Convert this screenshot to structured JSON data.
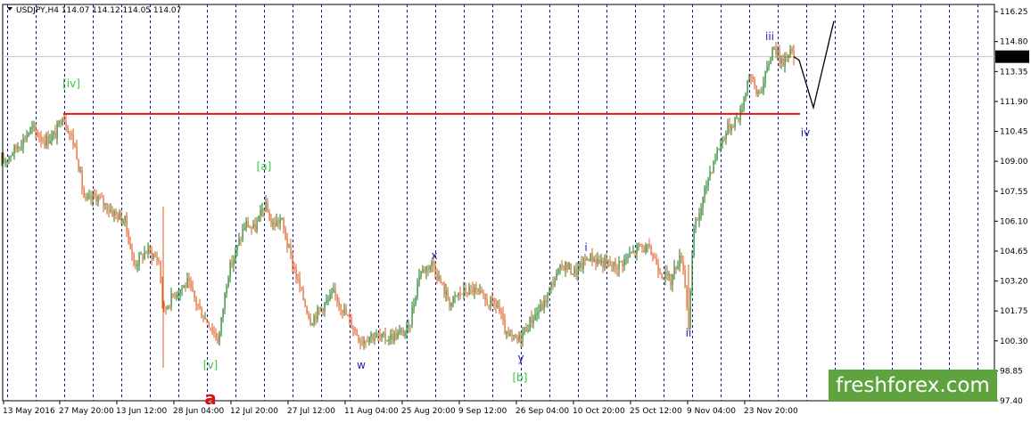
{
  "chart_data": {
    "type": "candlestick",
    "header": "USDJPY,H4  114.07 114.12 114.05 114.07",
    "symbol_menu_icon": "triangle-down-icon",
    "y_ticks": [
      "116.25",
      "114.80",
      "113.35",
      "111.90",
      "110.45",
      "109.00",
      "107.55",
      "106.10",
      "104.65",
      "103.20",
      "101.75",
      "100.30",
      "98.85",
      "97.40"
    ],
    "ylim": [
      97.4,
      116.6
    ],
    "x_ticks": [
      "13 May 2016",
      "27 May 20:00",
      "13 Jun 12:00",
      "28 Jun 04:00",
      "12 Jul 20:00",
      "27 Jul 12:00",
      "11 Aug 04:00",
      "25 Aug 20:00",
      "9 Sep 12:00",
      "26 Sep 04:00",
      "10 Oct 20:00",
      "25 Oct 12:00",
      "9 Nov 04:00",
      "23 Nov 20:00"
    ],
    "current_price": "114.07",
    "support_level": 111.3,
    "price_path": [
      [
        0,
        108.8
      ],
      [
        25,
        110.0
      ],
      [
        35,
        110.6
      ],
      [
        50,
        110.0
      ],
      [
        62,
        110.3
      ],
      [
        70,
        111.3
      ],
      [
        85,
        109.6
      ],
      [
        95,
        107.0
      ],
      [
        108,
        107.3
      ],
      [
        125,
        106.6
      ],
      [
        140,
        106.1
      ],
      [
        150,
        104.0
      ],
      [
        165,
        104.7
      ],
      [
        178,
        104.2
      ],
      [
        183,
        101.7
      ],
      [
        195,
        102.6
      ],
      [
        210,
        103.1
      ],
      [
        225,
        101.7
      ],
      [
        235,
        101.1
      ],
      [
        245,
        100.3
      ],
      [
        255,
        103.5
      ],
      [
        265,
        104.7
      ],
      [
        275,
        106.0
      ],
      [
        285,
        105.7
      ],
      [
        297,
        106.9
      ],
      [
        305,
        105.9
      ],
      [
        315,
        106.2
      ],
      [
        325,
        104.5
      ],
      [
        335,
        103.0
      ],
      [
        348,
        101.3
      ],
      [
        360,
        101.9
      ],
      [
        375,
        102.6
      ],
      [
        390,
        101.4
      ],
      [
        405,
        100.3
      ],
      [
        415,
        100.6
      ],
      [
        430,
        100.4
      ],
      [
        445,
        100.6
      ],
      [
        458,
        100.8
      ],
      [
        470,
        103.6
      ],
      [
        485,
        104.1
      ],
      [
        495,
        103.0
      ],
      [
        505,
        102.1
      ],
      [
        515,
        102.6
      ],
      [
        530,
        102.8
      ],
      [
        545,
        102.2
      ],
      [
        558,
        102.0
      ],
      [
        568,
        100.5
      ],
      [
        580,
        100.3
      ],
      [
        595,
        101.3
      ],
      [
        610,
        102.1
      ],
      [
        620,
        103.2
      ],
      [
        632,
        104.0
      ],
      [
        645,
        103.6
      ],
      [
        660,
        104.4
      ],
      [
        675,
        104.1
      ],
      [
        690,
        103.9
      ],
      [
        705,
        104.4
      ],
      [
        718,
        104.9
      ],
      [
        730,
        104.6
      ],
      [
        742,
        103.6
      ],
      [
        752,
        103.2
      ],
      [
        758,
        104.0
      ],
      [
        765,
        104.4
      ],
      [
        772,
        101.1
      ],
      [
        778,
        105.7
      ],
      [
        785,
        106.6
      ],
      [
        795,
        108.4
      ],
      [
        805,
        109.6
      ],
      [
        812,
        110.3
      ],
      [
        820,
        110.8
      ],
      [
        830,
        111.3
      ],
      [
        840,
        113.3
      ],
      [
        848,
        112.3
      ],
      [
        855,
        112.6
      ],
      [
        862,
        113.8
      ],
      [
        868,
        114.7
      ],
      [
        876,
        113.7
      ],
      [
        884,
        114.4
      ],
      [
        890,
        114.07
      ]
    ],
    "projection": [
      [
        890,
        114.07
      ],
      [
        896,
        113.9
      ],
      [
        912,
        111.6
      ],
      [
        935,
        115.8
      ]
    ],
    "annotations": [
      {
        "text": "[iv]",
        "color": "#35c835",
        "x": 80,
        "y": 98
      },
      {
        "text": "[a]",
        "color": "#35c835",
        "x": 296,
        "y": 191
      },
      {
        "text": "[v]",
        "color": "#35c835",
        "x": 236,
        "y": 414
      },
      {
        "text": "[b]",
        "color": "#35c835",
        "x": 583,
        "y": 428
      },
      {
        "text": "a",
        "color": "#dd1111",
        "x": 236,
        "y": 454
      },
      {
        "text": "w",
        "color": "#2020b0",
        "x": 405,
        "y": 414
      },
      {
        "text": "x",
        "color": "#2020b0",
        "x": 487,
        "y": 291
      },
      {
        "text": "y",
        "color": "#2020b0",
        "x": 584,
        "y": 406
      },
      {
        "text": "i",
        "color": "#2020b0",
        "x": 657,
        "y": 282
      },
      {
        "text": "ii",
        "color": "#2020b0",
        "x": 772,
        "y": 378
      },
      {
        "text": "iii",
        "color": "#2020b0",
        "x": 863,
        "y": 45
      },
      {
        "text": "iv",
        "color": "#2020b0",
        "x": 903,
        "y": 153
      }
    ],
    "colors": {
      "bull": "#1a7a1a",
      "bear": "#e0551a",
      "support": "#ee1111",
      "period_sep": "#1010a0"
    },
    "watermark": "freshforex.com"
  }
}
